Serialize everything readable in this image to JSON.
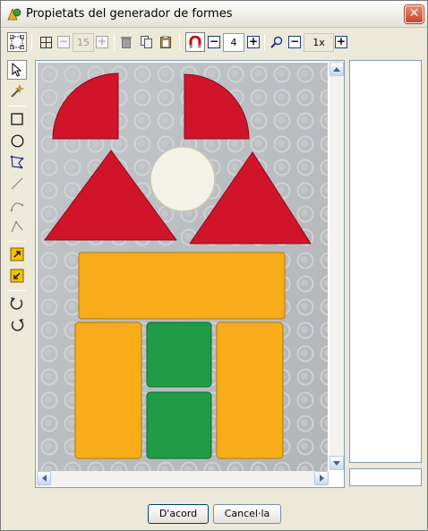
{
  "window": {
    "title": "Propietats del generador de formes",
    "close_glyph": "✕"
  },
  "toolbar": {
    "grid_count": "15",
    "magnet_value": "4",
    "zoom_value": "1x",
    "minus": "−",
    "plus": "+",
    "icons": [
      "select-nodes-icon",
      "grid-icon",
      "trash-icon",
      "copy-icon",
      "paste-icon",
      "magnet-icon",
      "zoom-icon"
    ]
  },
  "tools": {
    "icons": [
      "pointer-icon",
      "magic-wand-icon",
      "rectangle-icon",
      "ellipse-icon",
      "polygon-icon",
      "line-icon",
      "curve-icon",
      "polyline-icon",
      "enlarge-icon",
      "shrink-icon",
      "rotate-cw-icon",
      "rotate-ccw-icon"
    ]
  },
  "buttons": {
    "ok": "D'acord",
    "cancel": "Cancel·la"
  },
  "colors": {
    "red_piece": "#d0152a",
    "yellow_piece": "#f8ac1a",
    "green_piece": "#1f9c45",
    "white_piece": "#f4f2e6",
    "board": "#bfc3c7"
  }
}
